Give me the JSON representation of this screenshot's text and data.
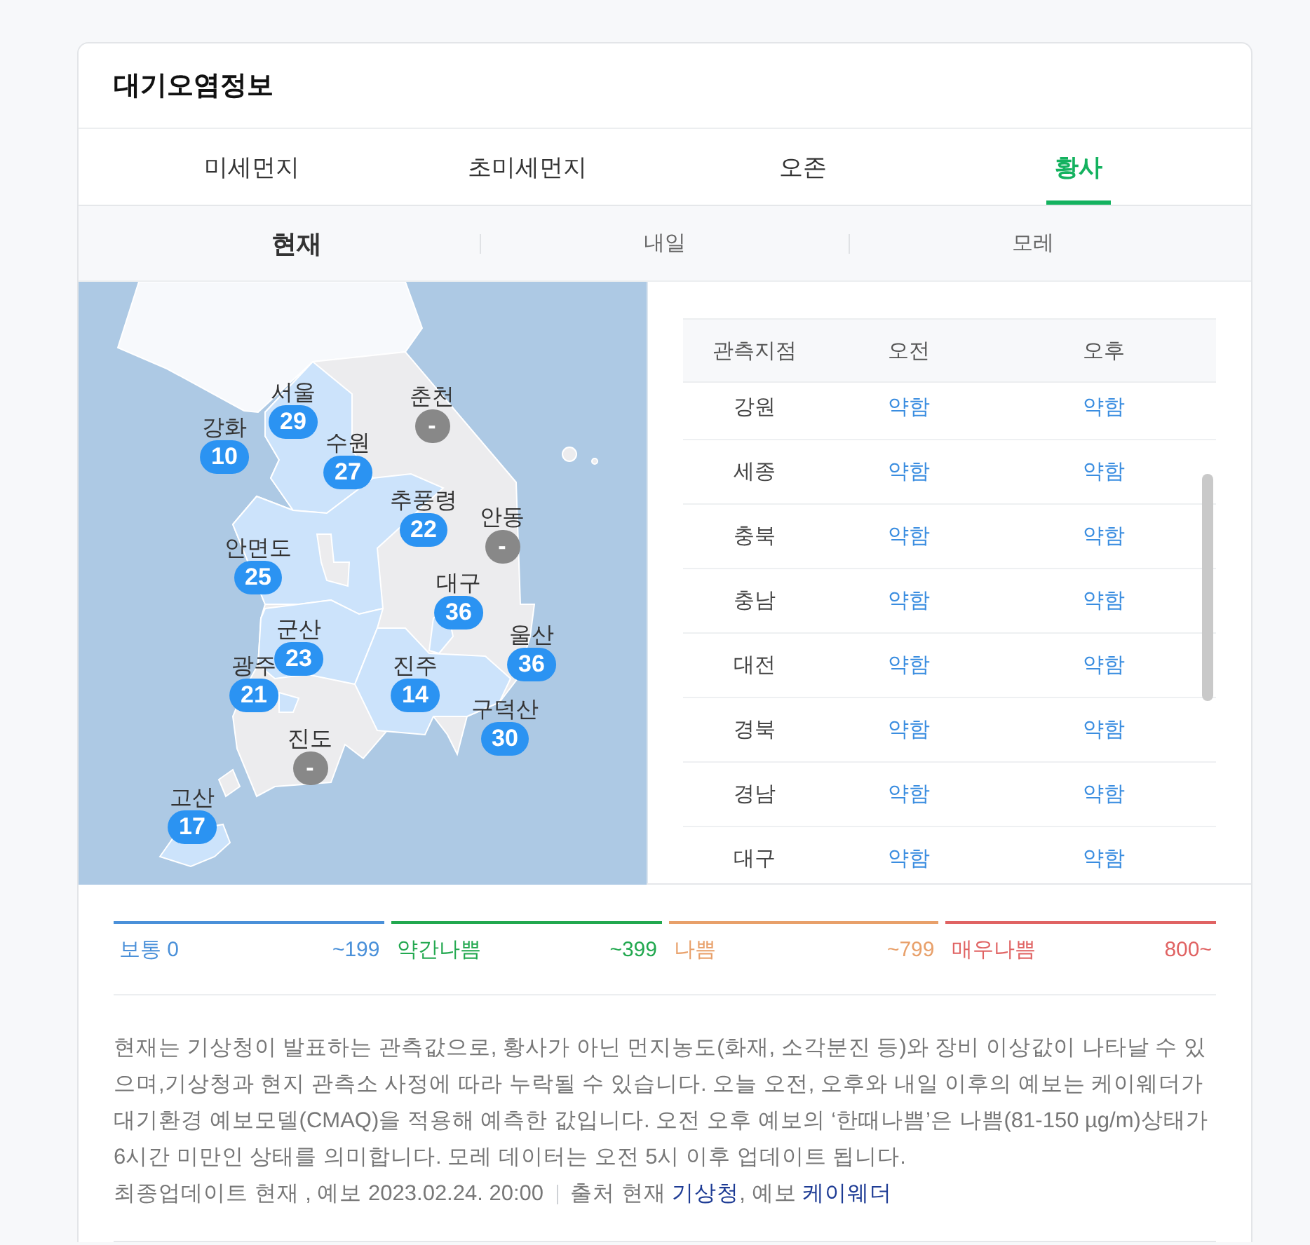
{
  "title": "대기오염정보",
  "tabs": [
    {
      "label": "미세먼지",
      "selected": false
    },
    {
      "label": "초미세먼지",
      "selected": false
    },
    {
      "label": "오존",
      "selected": false
    },
    {
      "label": "황사",
      "selected": true
    }
  ],
  "periods": [
    {
      "label": "현재",
      "selected": true
    },
    {
      "label": "내일",
      "selected": false
    },
    {
      "label": "모레",
      "selected": false
    }
  ],
  "map": {
    "markers": [
      {
        "name": "서울",
        "value": "29",
        "color": "#2b93f2"
      },
      {
        "name": "춘천",
        "value": "-",
        "color": "#888888"
      },
      {
        "name": "강화",
        "value": "10",
        "color": "#2b93f2"
      },
      {
        "name": "수원",
        "value": "27",
        "color": "#2b93f2"
      },
      {
        "name": "추풍령",
        "value": "22",
        "color": "#2b93f2"
      },
      {
        "name": "안동",
        "value": "-",
        "color": "#888888"
      },
      {
        "name": "안면도",
        "value": "25",
        "color": "#2b93f2"
      },
      {
        "name": "대구",
        "value": "36",
        "color": "#2b93f2"
      },
      {
        "name": "군산",
        "value": "23",
        "color": "#2b93f2"
      },
      {
        "name": "울산",
        "value": "36",
        "color": "#2b93f2"
      },
      {
        "name": "광주",
        "value": "21",
        "color": "#2b93f2"
      },
      {
        "name": "진주",
        "value": "14",
        "color": "#2b93f2"
      },
      {
        "name": "구덕산",
        "value": "30",
        "color": "#2b93f2"
      },
      {
        "name": "진도",
        "value": "-",
        "color": "#888888"
      },
      {
        "name": "고산",
        "value": "17",
        "color": "#2b93f2"
      }
    ]
  },
  "table": {
    "columns": [
      "관측지점",
      "오전",
      "오후"
    ],
    "rows": [
      {
        "station": "강원",
        "am": "약함",
        "pm": "약함"
      },
      {
        "station": "세종",
        "am": "약함",
        "pm": "약함"
      },
      {
        "station": "충북",
        "am": "약함",
        "pm": "약함"
      },
      {
        "station": "충남",
        "am": "약함",
        "pm": "약함"
      },
      {
        "station": "대전",
        "am": "약함",
        "pm": "약함"
      },
      {
        "station": "경북",
        "am": "약함",
        "pm": "약함"
      },
      {
        "station": "경남",
        "am": "약함",
        "pm": "약함"
      },
      {
        "station": "대구",
        "am": "약함",
        "pm": "약함"
      }
    ]
  },
  "legend": [
    {
      "label": "보통 0",
      "range": "~199",
      "color": "#4a90d9"
    },
    {
      "label": "약간나쁨",
      "range": "~399",
      "color": "#22a84f"
    },
    {
      "label": "나쁨",
      "range": "~799",
      "color": "#e8a06a"
    },
    {
      "label": "매우나쁨",
      "range": "800~",
      "color": "#e06363"
    }
  ],
  "note": "현재는 기상청이 발표하는 관측값으로, 황사가 아닌 먼지농도(화재, 소각분진 등)와 장비 이상값이 나타날 수 있으며,기상청과 현지 관측소 사정에 따라 누락될 수 있습니다. 오늘 오전, 오후와 내일 이후의 예보는 케이웨더가 대기환경 예보모델(CMAQ)을 적용해 예측한 값입니다. 오전 오후 예보의 ‘한때나쁨’은 나쁨(81-150 µg/m)상태가 6시간 미만인 상태를 의미합니다. 모레 데이터는 오전 5시 이후 업데이트 됩니다.",
  "footer": {
    "updated": "최종업데이트 현재 , 예보 2023.02.24. 20:00",
    "source": [
      {
        "kind": "text",
        "text": "출처 현재 "
      },
      {
        "kind": "link",
        "text": "기상청"
      },
      {
        "kind": "text",
        "text": ", 예보 "
      },
      {
        "kind": "link",
        "text": "케이웨더"
      }
    ]
  }
}
